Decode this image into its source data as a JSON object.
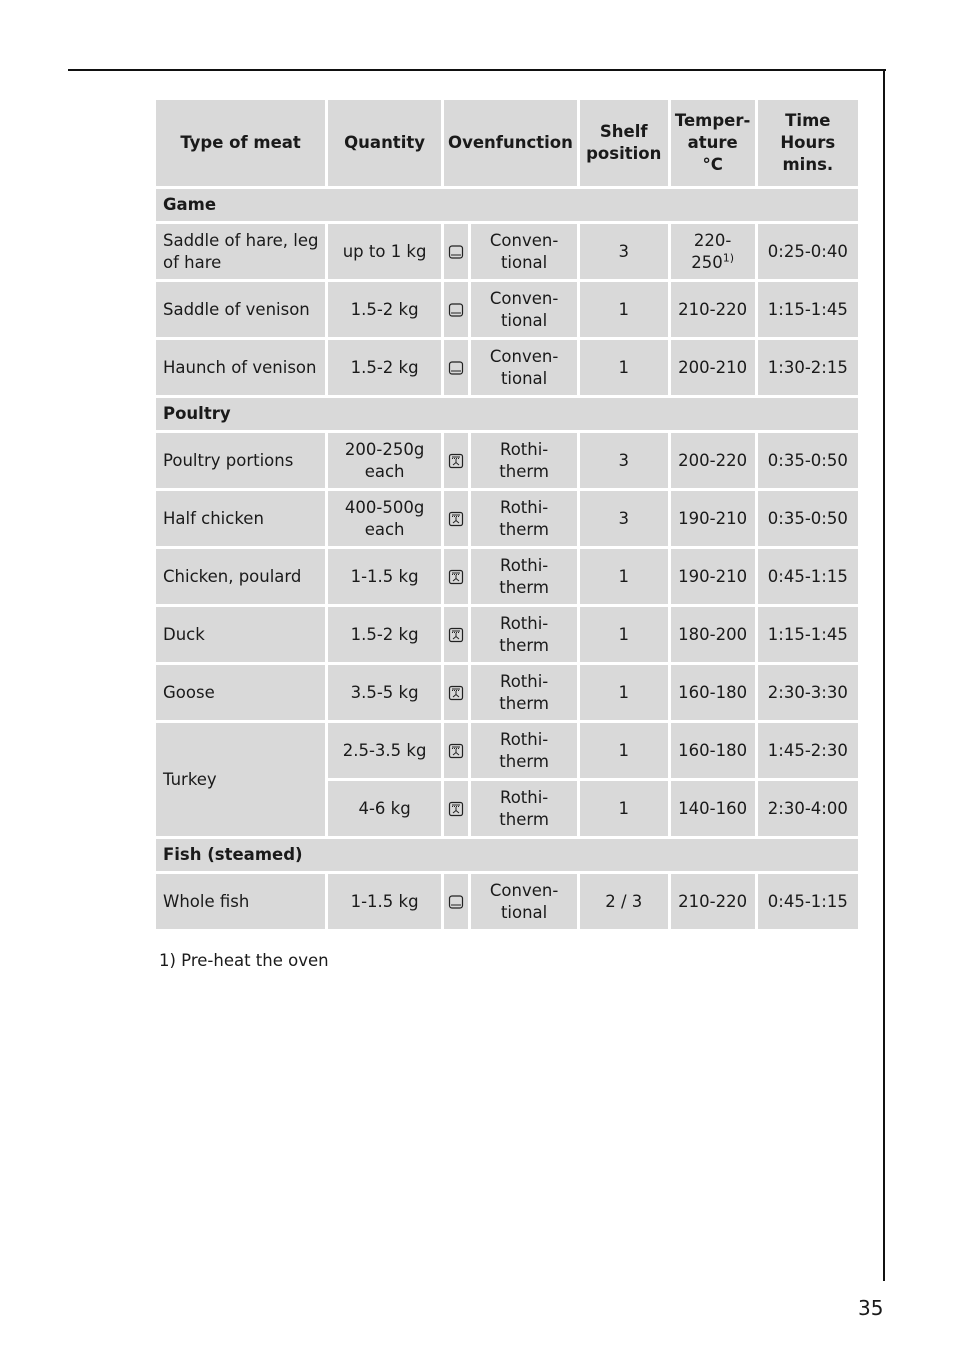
{
  "table": {
    "headers": {
      "type": "Type of meat",
      "quantity": "Quantity",
      "ovenfunction": "Ovenfunction",
      "shelf_l1": "Shelf",
      "shelf_l2": "position",
      "temp_l1": "Temper-",
      "temp_l2": "ature",
      "temp_l3": "°C",
      "time_l1": "Time",
      "time_l2": "Hours",
      "time_l3": "mins."
    },
    "groups": [
      {
        "label": "Game"
      },
      {
        "label": "Poultry"
      },
      {
        "label": "Fish (steamed)"
      }
    ],
    "rows": [
      {
        "meat": "Saddle of hare, leg of hare",
        "qty_l1": "up to 1 kg",
        "qty_l2": "",
        "icon": "conventional-icon",
        "fn_l1": "Conven-",
        "fn_l2": "tional",
        "shelf": "3",
        "temp_l1": "220-",
        "temp_l2": "250",
        "temp_note": "1)",
        "time": "0:25-0:40"
      },
      {
        "meat": "Saddle of venison",
        "qty_l1": "1.5-2 kg",
        "qty_l2": "",
        "icon": "conventional-icon",
        "fn_l1": "Conven-",
        "fn_l2": "tional",
        "shelf": "1",
        "temp": "210-220",
        "time": "1:15-1:45"
      },
      {
        "meat": "Haunch of venison",
        "qty_l1": "1.5-2 kg",
        "qty_l2": "",
        "icon": "conventional-icon",
        "fn_l1": "Conven-",
        "fn_l2": "tional",
        "shelf": "1",
        "temp": "200-210",
        "time": "1:30-2:15"
      },
      {
        "meat": "Poultry portions",
        "qty_l1": "200-250g",
        "qty_l2": "each",
        "icon": "rotitherm-icon",
        "fn_l1": "Rothi-",
        "fn_l2": "therm",
        "shelf": "3",
        "temp": "200-220",
        "time": "0:35-0:50"
      },
      {
        "meat": "Half chicken",
        "qty_l1": "400-500g",
        "qty_l2": "each",
        "icon": "rotitherm-icon",
        "fn_l1": "Rothi-",
        "fn_l2": "therm",
        "shelf": "3",
        "temp": "190-210",
        "time": "0:35-0:50"
      },
      {
        "meat": "Chicken, poulard",
        "qty_l1": "1-1.5 kg",
        "qty_l2": "",
        "icon": "rotitherm-icon",
        "fn_l1": "Rothi-",
        "fn_l2": "therm",
        "shelf": "1",
        "temp": "190-210",
        "time": "0:45-1:15"
      },
      {
        "meat": "Duck",
        "qty_l1": "1.5-2 kg",
        "qty_l2": "",
        "icon": "rotitherm-icon",
        "fn_l1": "Rothi-",
        "fn_l2": "therm",
        "shelf": "1",
        "temp": "180-200",
        "time": "1:15-1:45"
      },
      {
        "meat": "Goose",
        "qty_l1": "3.5-5 kg",
        "qty_l2": "",
        "icon": "rotitherm-icon",
        "fn_l1": "Rothi-",
        "fn_l2": "therm",
        "shelf": "1",
        "temp": "160-180",
        "time": "2:30-3:30"
      },
      {
        "meat": "Turkey",
        "qty_l1": "2.5-3.5 kg",
        "qty_l2": "",
        "icon": "rotitherm-icon",
        "fn_l1": "Rothi-",
        "fn_l2": "therm",
        "shelf": "1",
        "temp": "160-180",
        "time": "1:45-2:30"
      },
      {
        "meat": "",
        "qty_l1": "4-6 kg",
        "qty_l2": "",
        "icon": "rotitherm-icon",
        "fn_l1": "Rothi-",
        "fn_l2": "therm",
        "shelf": "1",
        "temp": "140-160",
        "time": "2:30-4:00"
      },
      {
        "meat": "Whole fish",
        "qty_l1": "1-1.5 kg",
        "qty_l2": "",
        "icon": "conventional-icon",
        "fn_l1": "Conven-",
        "fn_l2": "tional",
        "shelf": "2 / 3",
        "temp": "210-220",
        "time": "0:45-1:15"
      }
    ]
  },
  "footnote": "1) Pre-heat the oven",
  "page_number": "35"
}
